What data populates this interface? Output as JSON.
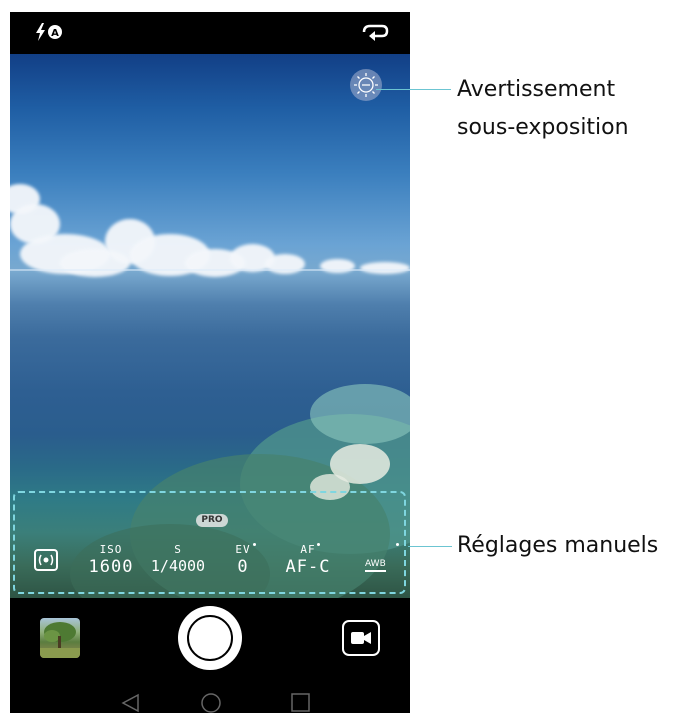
{
  "status_bar": {
    "flash_icon": "flash-auto-icon",
    "switch_camera_icon": "switch-camera-icon"
  },
  "viewfinder": {
    "exposure_warning_icon": "exposure-warning-icon"
  },
  "pro_mode": {
    "badge": "PRO",
    "metering_icon": "metering-mode-icon",
    "params": [
      {
        "label": "ISO",
        "value": "1600"
      },
      {
        "label": "S",
        "value": "1/4000"
      },
      {
        "label": "EV",
        "value": "0"
      },
      {
        "label": "AF",
        "value": "AF-C"
      }
    ],
    "awb": "AWB"
  },
  "controls": {
    "gallery_icon": "gallery-thumbnail",
    "shutter_icon": "shutter-icon",
    "video_icon": "video-camera-icon"
  },
  "navbar": {
    "back_icon": "back-icon",
    "home_icon": "home-icon",
    "recents_icon": "recents-icon"
  },
  "callouts": {
    "underexposure_line1": "Avertissement",
    "underexposure_line2": "sous-exposition",
    "manual_settings": "Réglages manuels"
  },
  "colors": {
    "callout_line": "#6cc5d2",
    "panel_border": "#7fd6e0"
  }
}
